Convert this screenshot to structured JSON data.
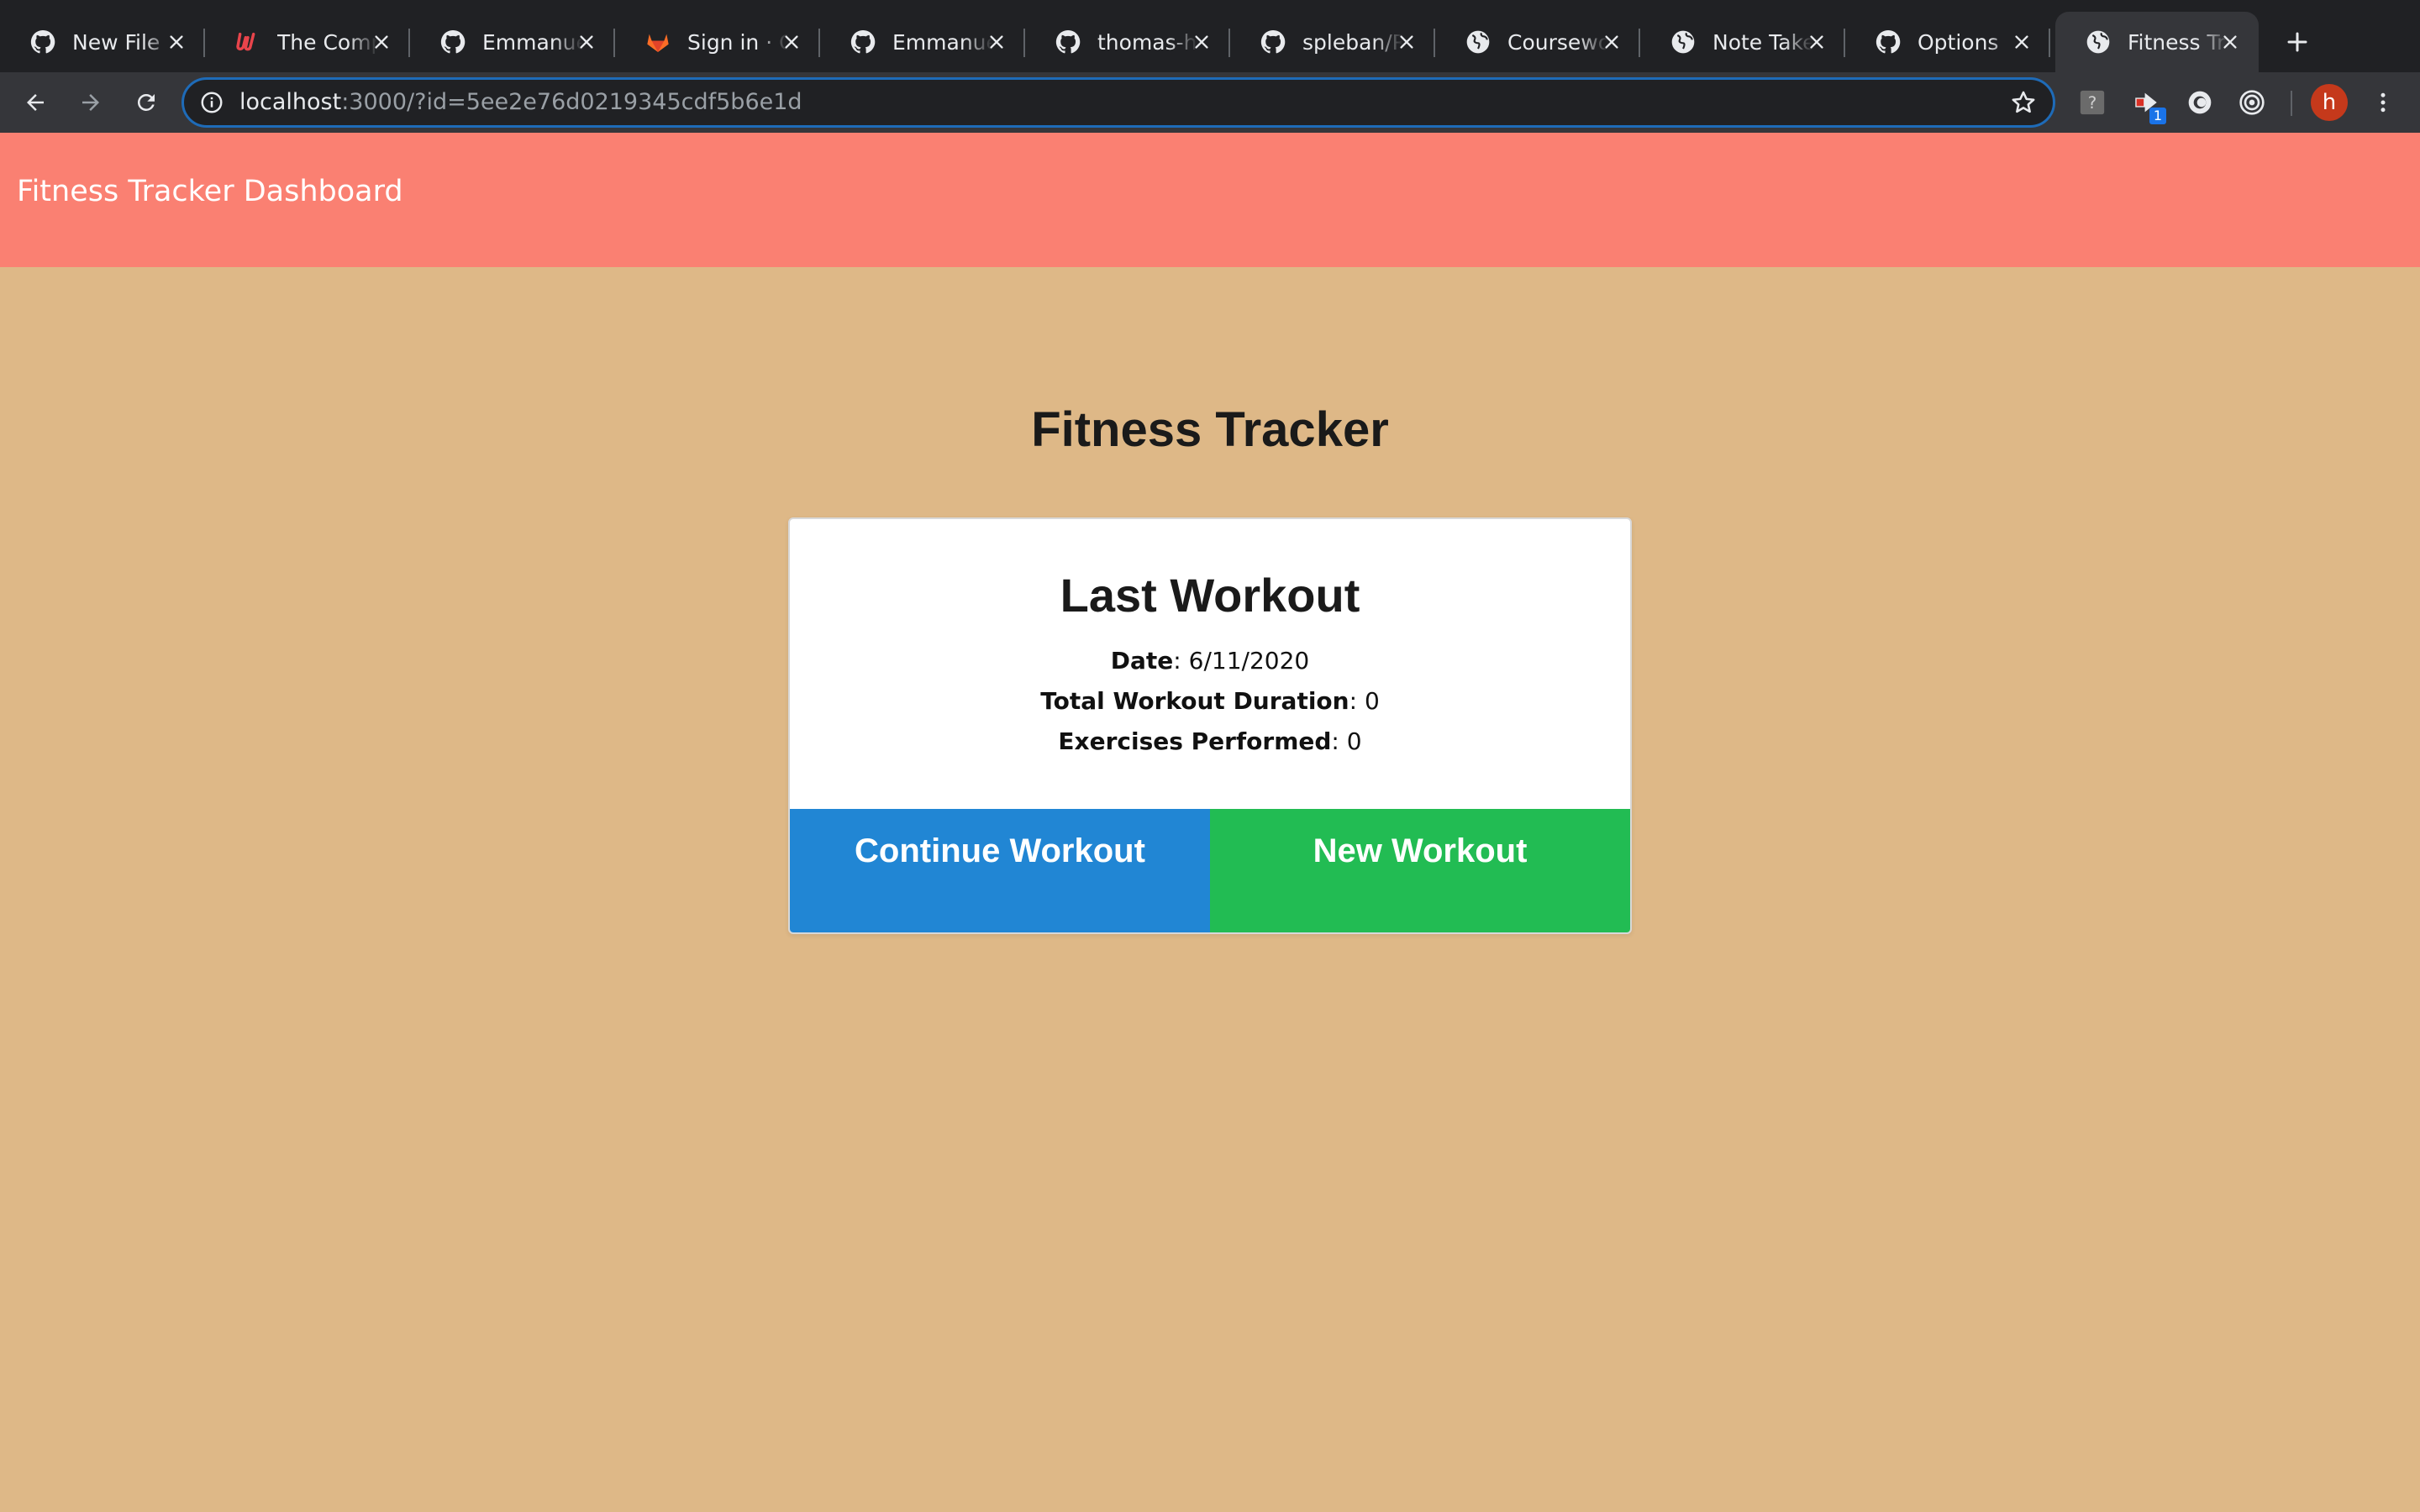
{
  "browser": {
    "tabs": [
      {
        "title": "New File",
        "icon": "github-icon"
      },
      {
        "title": "The Comp",
        "icon": "u-logo-icon"
      },
      {
        "title": "Emmanuel",
        "icon": "github-icon"
      },
      {
        "title": "Sign in · G",
        "icon": "gitlab-icon"
      },
      {
        "title": "Emmanuel",
        "icon": "github-icon"
      },
      {
        "title": "thomas-h",
        "icon": "github-icon"
      },
      {
        "title": "spleban/R",
        "icon": "github-icon"
      },
      {
        "title": "Coursewo",
        "icon": "globe-icon"
      },
      {
        "title": "Note Take",
        "icon": "globe-icon"
      },
      {
        "title": "Options",
        "icon": "github-icon"
      },
      {
        "title": "Fitness Tra",
        "icon": "globe-icon",
        "active": true
      }
    ],
    "url_host": "localhost",
    "url_rest": ":3000/?id=5ee2e76d0219345cdf5b6e1d",
    "extension_badge": "1",
    "profile_initial": "h",
    "accent_color": "#1E6BB8"
  },
  "header": {
    "brand": "Fitness Tracker Dashboard",
    "color": "#FA8072"
  },
  "page": {
    "title": "Fitness Tracker",
    "background": "#DEB887"
  },
  "card": {
    "title": "Last Workout",
    "stats": {
      "date_label": "Date",
      "date_value": ": 6/11/2020",
      "duration_label": "Total Workout Duration",
      "duration_value": ": 0",
      "exercises_label": "Exercises Performed",
      "exercises_value": ": 0"
    },
    "buttons": {
      "continue": "Continue Workout",
      "new": "New Workout",
      "continue_color": "#2186D4",
      "new_color": "#22BC53"
    }
  }
}
